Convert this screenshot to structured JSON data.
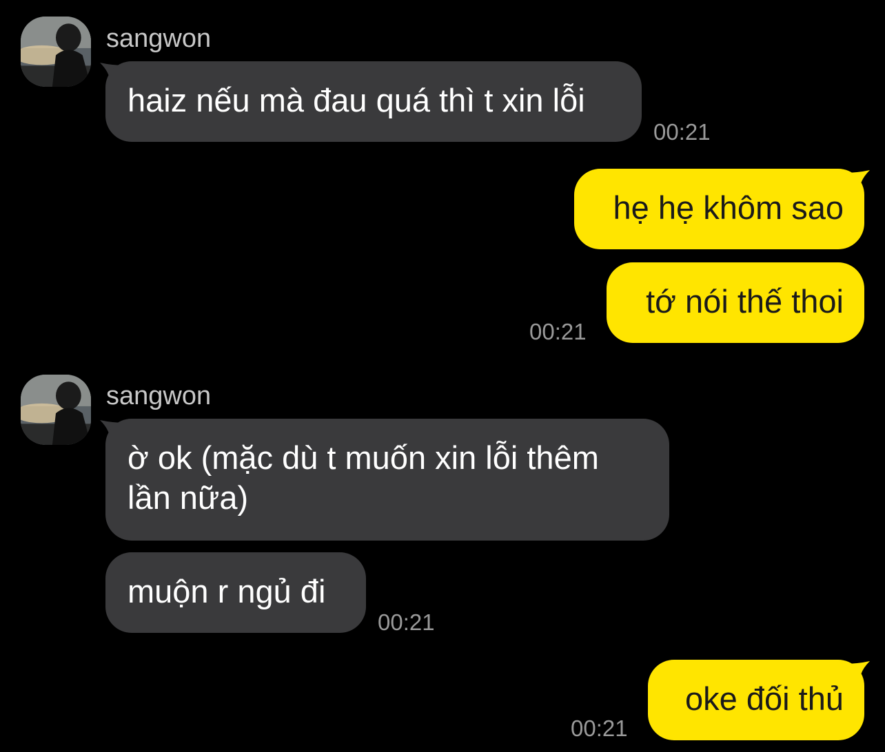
{
  "messages": [
    {
      "sender": "sangwon",
      "bubbles": [
        "haiz nếu mà đau quá thì t xin lỗi"
      ],
      "time": "00:21"
    },
    {
      "sender": "me",
      "bubbles": [
        "hẹ hẹ khôm sao",
        "tớ nói thế thoi"
      ],
      "time": "00:21"
    },
    {
      "sender": "sangwon",
      "bubbles": [
        "ờ ok (mặc dù t muốn xin lỗi thêm lần nữa)",
        "muộn r ngủ đi"
      ],
      "time": "00:21"
    },
    {
      "sender": "me",
      "bubbles": [
        "oke đối thủ"
      ],
      "time": "00:21"
    }
  ],
  "colors": {
    "background": "#000000",
    "incoming_bubble": "#3a3a3c",
    "outgoing_bubble": "#ffe500",
    "timestamp": "#9a9a9a",
    "sender_name": "#c8c8c8"
  },
  "icons": {
    "avatar": "profile-photo-avatar"
  }
}
